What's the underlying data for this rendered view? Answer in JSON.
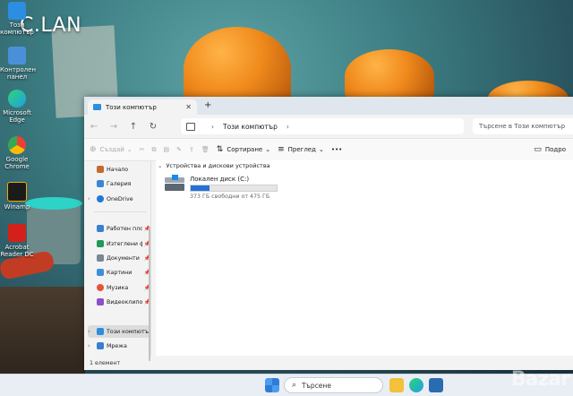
{
  "desktop": {
    "watermark": "C.LAN",
    "icons": [
      {
        "label": "Този компютър",
        "icon": "this-pc-icon",
        "color": "#2b8ee0"
      },
      {
        "label": "Контролен панел",
        "icon": "control-panel-icon",
        "color": "#4a90d9"
      },
      {
        "label": "Microsoft Edge",
        "icon": "edge-icon",
        "color": "#1fa0e0"
      },
      {
        "label": "Google Chrome",
        "icon": "chrome-icon",
        "color": "#e94235"
      },
      {
        "label": "Winamp",
        "icon": "winamp-icon",
        "color": "#f2a900"
      },
      {
        "label": "Acrobat Reader DC",
        "icon": "acrobat-icon",
        "color": "#d4201a"
      }
    ]
  },
  "window": {
    "tab_title": "Този компютър",
    "new_tab_symbol": "+",
    "address": {
      "location": "Този компютър",
      "search_placeholder": "Търсене в Този компютър"
    },
    "toolbar": {
      "new_label": "Създай",
      "sort_label": "Сортиране",
      "view_label": "Преглед",
      "more_label": "•••",
      "details_label": "Подро"
    },
    "sidebar": {
      "items": [
        {
          "label": "Начало",
          "icon": "home-icon",
          "color": "#c46a2f",
          "pinned": false,
          "expand": false
        },
        {
          "label": "Галерия",
          "icon": "gallery-icon",
          "color": "#3a86d4",
          "pinned": false,
          "expand": false
        },
        {
          "label": "OneDrive",
          "icon": "onedrive-icon",
          "color": "#1f7ad6",
          "pinned": false,
          "expand": true
        },
        {
          "label": "Работен плот",
          "icon": "desktop-icon",
          "color": "#3a7fd0",
          "pinned": true,
          "expand": false
        },
        {
          "label": "Изтеглени файлове",
          "icon": "downloads-icon",
          "color": "#1e9b5a",
          "pinned": true,
          "expand": false
        },
        {
          "label": "Документи",
          "icon": "documents-icon",
          "color": "#7a8794",
          "pinned": true,
          "expand": false
        },
        {
          "label": "Картини",
          "icon": "pictures-icon",
          "color": "#3f8fd8",
          "pinned": true,
          "expand": false
        },
        {
          "label": "Музика",
          "icon": "music-icon",
          "color": "#e5533a",
          "pinned": true,
          "expand": false
        },
        {
          "label": "Видеоклипове",
          "icon": "videos-icon",
          "color": "#8b4fc7",
          "pinned": true,
          "expand": false
        },
        {
          "label": "Този компютър",
          "icon": "this-pc-icon",
          "color": "#2b8ee0",
          "pinned": false,
          "expand": true,
          "selected": true
        },
        {
          "label": "Мрежа",
          "icon": "network-icon",
          "color": "#3a7fd0",
          "pinned": false,
          "expand": true
        }
      ]
    },
    "content": {
      "group_header": "Устройства и дискови устройства",
      "drives": [
        {
          "name": "Локален диск (C:)",
          "free_text": "373 ГБ свободни от 475 ГБ",
          "used_fraction": 0.215
        }
      ]
    },
    "status": "1 елемент"
  },
  "taskbar": {
    "search_placeholder": "Търсене",
    "watermark": "Bazar"
  },
  "colors": {
    "accent": "#2470d8",
    "window_bg": "#f3f3f3",
    "taskbar_bg": "#e9eef4"
  }
}
